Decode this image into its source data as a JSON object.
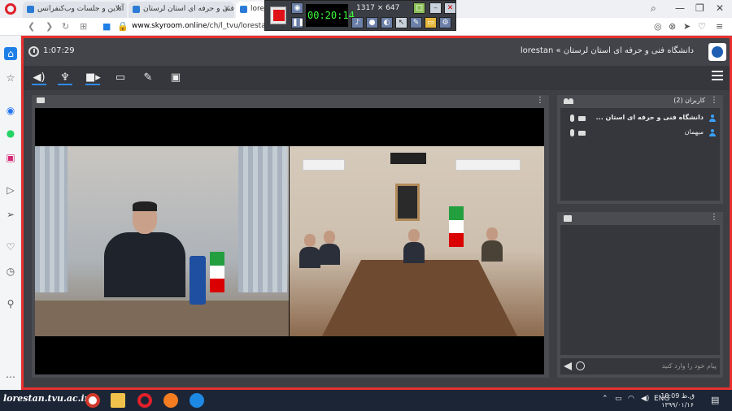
{
  "browser": {
    "tabs": [
      {
        "title": "آنلاین و جلسات وب‌کنفرانس"
      },
      {
        "title": "فنی و حرفه ای استان لرستان"
      },
      {
        "title": "lorest"
      }
    ],
    "url_host": "www.skyroom.online",
    "url_path": "/ch/l_tvu/lorestan"
  },
  "recorder": {
    "timer": "00:20:14",
    "size": "1317 × 647"
  },
  "app": {
    "elapsed_time": "1:07:29",
    "room_title": "دانشگاه فنی و حرفه ای استان لرستان » lorestan"
  },
  "users": {
    "title": "کاربران (2)",
    "list": [
      {
        "name": "دانشگاه فنی و حرفه ای استان ..."
      },
      {
        "name": "میهمان"
      }
    ]
  },
  "chat": {
    "placeholder": "پیام خود را وارد کنید"
  },
  "taskbar": {
    "watermark": "lorestan.tvu.ac.ir",
    "lang": "ENG",
    "time": "10:09 ق.ظ",
    "date": "۱۳۹۹/۰۱/۱۶"
  },
  "colors": {
    "recording_border": "#e83030",
    "accent": "#2e8be8",
    "panel_bg": "#4a4c52"
  }
}
